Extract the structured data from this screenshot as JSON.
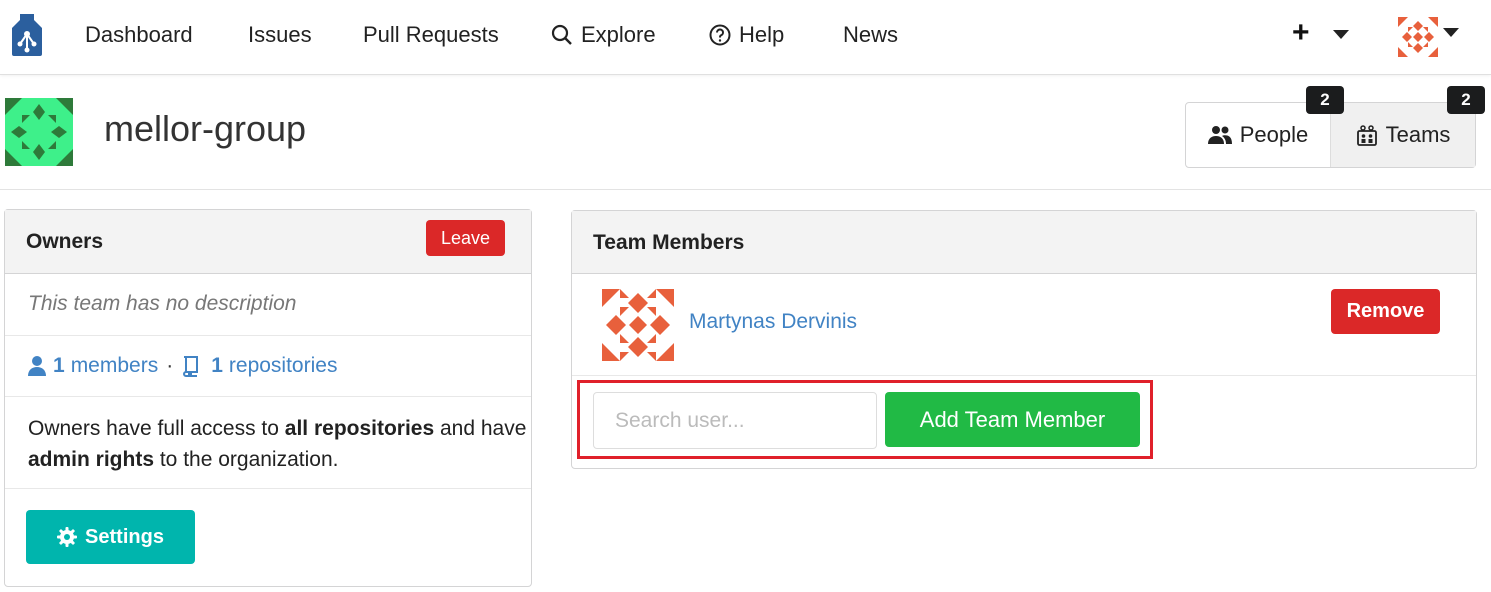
{
  "nav": {
    "items": [
      {
        "label": "Dashboard",
        "icon": ""
      },
      {
        "label": "Issues",
        "icon": ""
      },
      {
        "label": "Pull Requests",
        "icon": ""
      },
      {
        "label": "Explore",
        "icon": "search-icon"
      },
      {
        "label": "Help",
        "icon": "help-circle-icon"
      },
      {
        "label": "News",
        "icon": ""
      }
    ],
    "create_label": "+",
    "logo_icon": "gitea-logo-icon",
    "user_avatar_icon": "user-avatar-icon"
  },
  "org": {
    "name": "mellor-group",
    "tabs": [
      {
        "label": "People",
        "count": "2",
        "icon": "people-icon"
      },
      {
        "label": "Teams",
        "count": "2",
        "icon": "teams-icon"
      }
    ]
  },
  "team_panel": {
    "title": "Owners",
    "leave_label": "Leave",
    "description": "This team has no description",
    "members_count": "1",
    "members_label": "members",
    "separator": "·",
    "repos_count": "1",
    "repos_label": "repositories",
    "permission_text": {
      "p1": "Owners have full access to ",
      "b1": "all repositories",
      "p2": " and have ",
      "b2": "admin rights",
      "p3": " to the organization."
    },
    "settings_label": "Settings"
  },
  "members_panel": {
    "title": "Team Members",
    "members": [
      {
        "name": "Martynas Dervinis",
        "remove_label": "Remove"
      }
    ],
    "search_placeholder": "Search user...",
    "add_label": "Add Team Member"
  },
  "colors": {
    "danger": "#db2828",
    "teal": "#00b5ad",
    "green": "#21ba45",
    "link": "#4183c4",
    "highlight": "#e0202a"
  }
}
